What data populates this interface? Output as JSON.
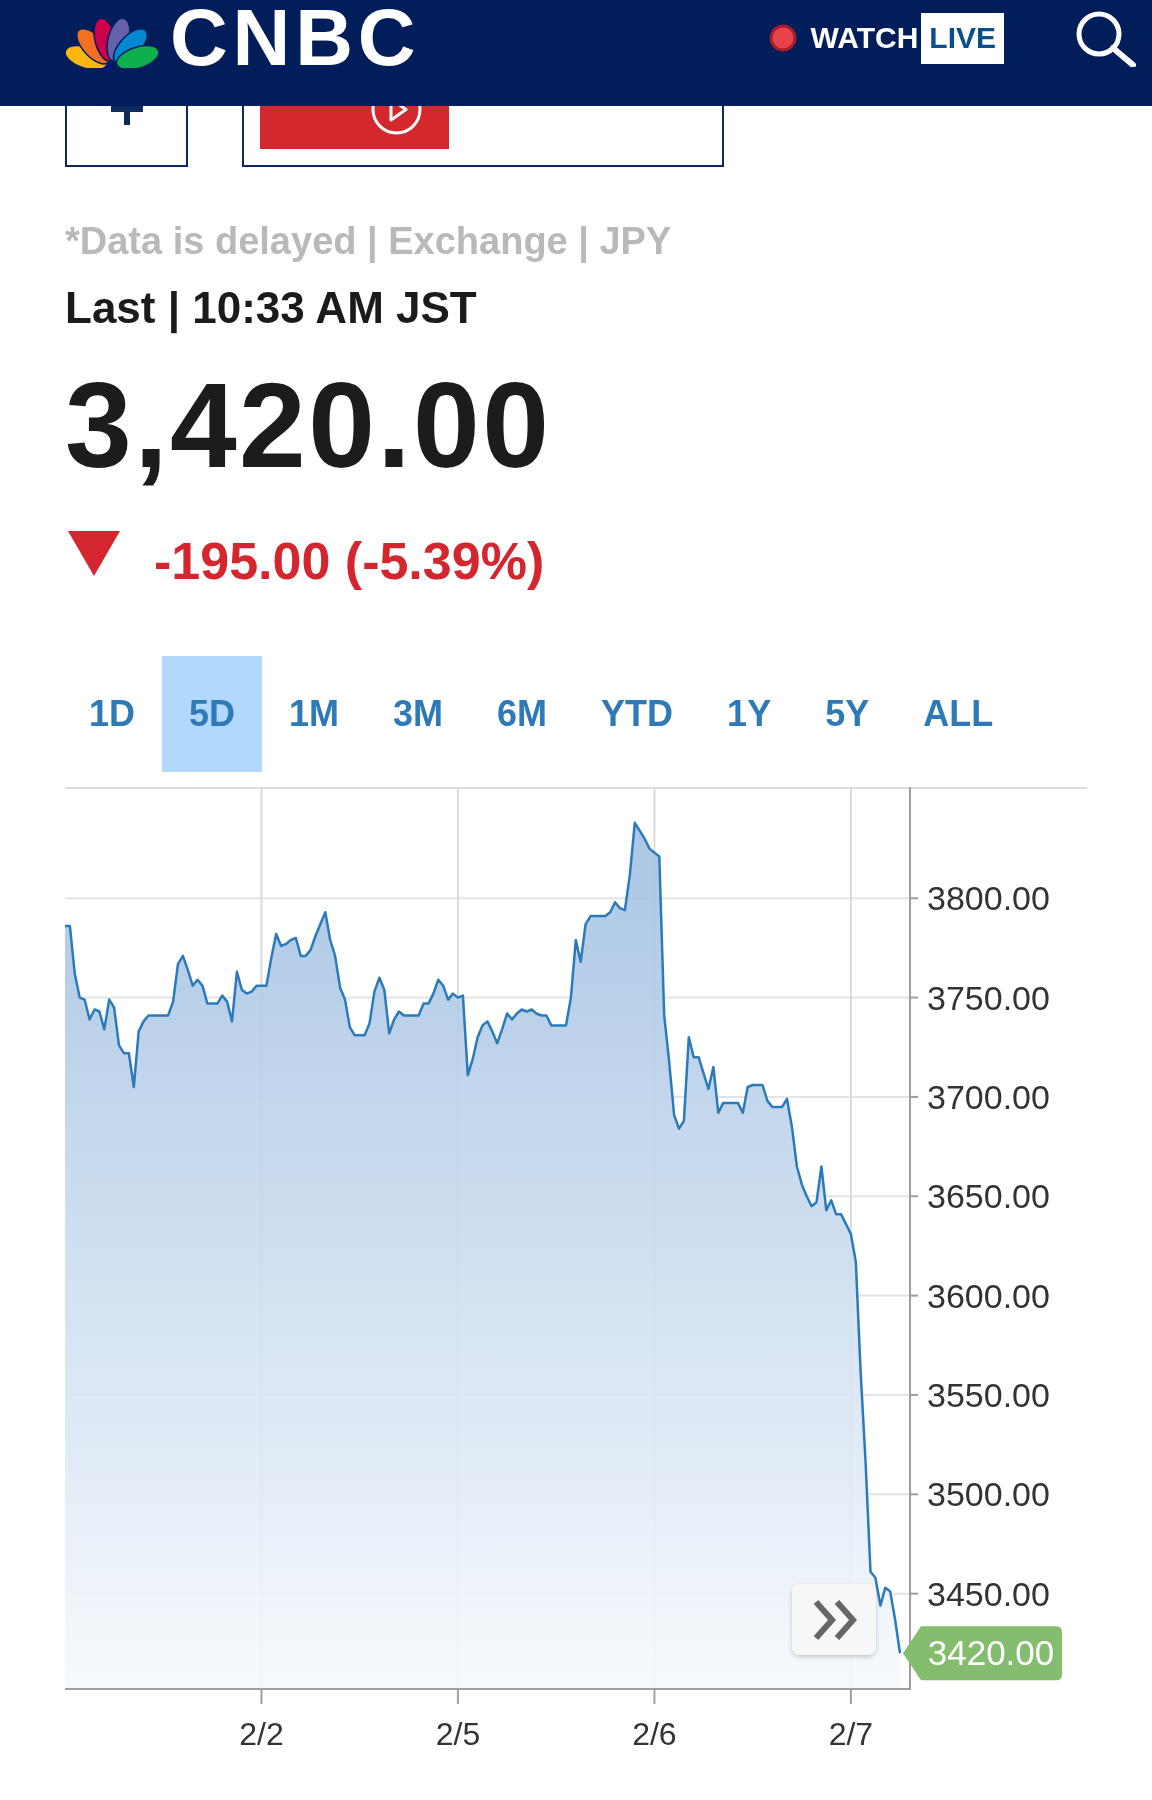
{
  "header": {
    "logo_text": "CNBC",
    "watch_label": "WATCH",
    "live_badge": "LIVE"
  },
  "quote": {
    "disclaimer": "*Data is delayed | Exchange | JPY",
    "last_time": "Last | 10:33 AM JST",
    "price": "3,420.00",
    "change": {
      "text": "-195.00 (-5.39%)",
      "down": true
    }
  },
  "range_tabs": [
    {
      "label": "1D",
      "selected": false
    },
    {
      "label": "5D",
      "selected": true
    },
    {
      "label": "1M",
      "selected": false
    },
    {
      "label": "3M",
      "selected": false
    },
    {
      "label": "6M",
      "selected": false
    },
    {
      "label": "YTD",
      "selected": false
    },
    {
      "label": "1Y",
      "selected": false
    },
    {
      "label": "5Y",
      "selected": false
    },
    {
      "label": "ALL",
      "selected": false
    }
  ],
  "chart": {
    "chart_data": {
      "type": "area",
      "grid": true,
      "categories": [
        null,
        null,
        null,
        null,
        null,
        null,
        null,
        null,
        null,
        null,
        null,
        null,
        null,
        null,
        null,
        null,
        null,
        null,
        null,
        null,
        null,
        null,
        null,
        null,
        null,
        null,
        null,
        null,
        null,
        null,
        null,
        null,
        null,
        null,
        null,
        null,
        null,
        null,
        null,
        null,
        "2/2",
        null,
        null,
        null,
        null,
        null,
        null,
        null,
        null,
        null,
        null,
        null,
        null,
        null,
        null,
        null,
        null,
        null,
        null,
        null,
        null,
        null,
        null,
        null,
        null,
        null,
        null,
        null,
        null,
        null,
        null,
        null,
        null,
        null,
        null,
        null,
        null,
        null,
        null,
        null,
        "2/5",
        null,
        null,
        null,
        null,
        null,
        null,
        null,
        null,
        null,
        null,
        null,
        null,
        null,
        null,
        null,
        null,
        null,
        null,
        null,
        null,
        null,
        null,
        null,
        null,
        null,
        null,
        null,
        null,
        null,
        null,
        null,
        null,
        null,
        null,
        null,
        null,
        null,
        null,
        null,
        "2/6",
        null,
        null,
        null,
        null,
        null,
        null,
        null,
        null,
        null,
        null,
        null,
        null,
        null,
        null,
        null,
        null,
        null,
        null,
        null,
        null,
        null,
        null,
        null,
        null,
        null,
        null,
        null,
        null,
        null,
        null,
        null,
        null,
        null,
        null,
        null,
        null,
        null,
        null,
        null,
        "2/7",
        null,
        null,
        null,
        null,
        null,
        null,
        null,
        null,
        null,
        null
      ],
      "series": [
        {
          "color": "#2b7bbb",
          "values": [
            3786,
            3786,
            3762,
            3750,
            3749,
            3739,
            3744,
            3743,
            3734,
            3749,
            3745,
            3726,
            3722,
            3722,
            3705,
            3733,
            3738,
            3741,
            3741,
            3741,
            3741,
            3741,
            3748,
            3767,
            3771,
            3764,
            3756,
            3759,
            3756,
            3747,
            3747,
            3747,
            3751,
            3748,
            3738,
            3763,
            3754,
            3752,
            3753,
            3756,
            3756,
            3756,
            3770,
            3782,
            3776,
            3777,
            3779,
            3780,
            3771,
            3771,
            3774,
            3781,
            3787,
            3793,
            3779,
            3771,
            3755,
            3749,
            3735,
            3731,
            3731,
            3731,
            3737,
            3753,
            3760,
            3754,
            3732,
            3739,
            3743,
            3741,
            3741,
            3741,
            3741,
            3747,
            3747,
            3752,
            3759,
            3756,
            3749,
            3752,
            3750,
            3751,
            3711,
            3719,
            3730,
            3736,
            3738,
            3733,
            3727,
            3734,
            3742,
            3739,
            3742,
            3744,
            3743,
            3744,
            3742,
            3741,
            3741,
            3736,
            3736,
            3736,
            3736,
            3750,
            3779,
            3768,
            3787,
            3791,
            3791,
            3791,
            3791,
            3793,
            3798,
            3795,
            3794,
            3812,
            3838,
            3834,
            3830,
            3825,
            3823,
            3821,
            3741,
            3718,
            3691,
            3684,
            3688,
            3730,
            3720,
            3720,
            3712,
            3704,
            3715,
            3692,
            3697,
            3697,
            3697,
            3697,
            3692,
            3705,
            3706,
            3706,
            3706,
            3698,
            3695,
            3695,
            3695,
            3699,
            3685,
            3665,
            3656,
            3650,
            3645,
            3647,
            3665,
            3643,
            3648,
            3641,
            3641,
            3636,
            3631,
            3617,
            3561,
            3516,
            3461,
            3458,
            3444,
            3453,
            3451,
            3437,
            3420
          ]
        }
      ],
      "ylim": [
        3402,
        3856
      ],
      "yticks": [
        {
          "value": 3450,
          "label": "3450.00"
        },
        {
          "value": 3500,
          "label": "3500.00"
        },
        {
          "value": 3550,
          "label": "3550.00"
        },
        {
          "value": 3600,
          "label": "3600.00"
        },
        {
          "value": 3650,
          "label": "3650.00"
        },
        {
          "value": 3700,
          "label": "3700.00"
        },
        {
          "value": 3750,
          "label": "3750.00"
        },
        {
          "value": 3800,
          "label": "3800.00"
        }
      ],
      "annotations": [
        "3420.00"
      ]
    }
  }
}
